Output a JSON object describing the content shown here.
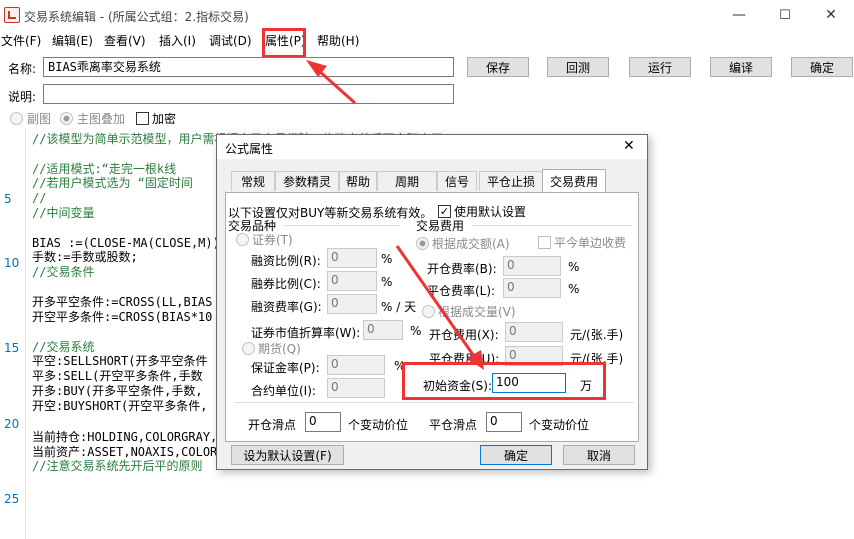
{
  "window": {
    "title": "交易系统编辑 - (所属公式组：2.指标交易)",
    "minimize": "—",
    "maximize": "☐",
    "close": "✕"
  },
  "menu": [
    "文件(F)",
    "编辑(E)",
    "查看(V)",
    "插入(I)",
    "调试(D)",
    "属性(P)",
    "帮助(H)"
  ],
  "form": {
    "name_label": "名称:",
    "name_value": "BIAS乖离率交易系统",
    "desc_label": "说明:",
    "desc_value": "",
    "radio_subchart": "副图",
    "radio_main_overlay": "主图叠加",
    "encrypt": "加密"
  },
  "toolbar": {
    "save": "保存",
    "revert": "回测",
    "run": "运行",
    "compile": "编译",
    "ok": "确定"
  },
  "gutter": [
    "5",
    "10",
    "15",
    "20",
    "25"
  ],
  "code": [
    {
      "t": "//该模型为简单示范模型，用户需根据自己交易经验，修改完善后再实际应用!!!"
    },
    {
      "t": ""
    },
    {
      "t": "//适用模式:“走完一根k线"
    },
    {
      "t": "//若用户模式选为 “固定时间"
    },
    {
      "t": "//"
    },
    {
      "t": "//中间变量"
    },
    {
      "t": ""
    },
    {
      "t": "BIAS :=(CLOSE-MA(CLOSE,M))/MA(CLOSE,M)*100;"
    },
    {
      "t": "手数:=手数或股数;"
    },
    {
      "t": "//交易条件"
    },
    {
      "t": ""
    },
    {
      "t": "开多平空条件:=CROSS(LL,BIAS"
    },
    {
      "t": "开空平多条件:=CROSS(BIAS*10"
    },
    {
      "t": ""
    },
    {
      "t": "//交易系统"
    },
    {
      "t": "平空:SELLSHORT(开多平空条件"
    },
    {
      "t": "平多:SELL(开空平多条件,手数"
    },
    {
      "t": "开多:BUY(开多平空条件,手数,"
    },
    {
      "t": "开空:BUYSHORT(开空平多条件,"
    },
    {
      "t": ""
    },
    {
      "t": "当前持仓:HOLDING,COLORGRAY,"
    },
    {
      "t": "当前资产:ASSET,NOAXIS,COLOR"
    },
    {
      "t": "//注意交易系统先开后平的原则"
    }
  ],
  "dialog": {
    "title": "公式属性",
    "close": "✕",
    "tabs": [
      "常规",
      "参数精灵",
      "帮助",
      "周期",
      "信号",
      "平仓止损",
      "交易费用"
    ],
    "active_tab": "交易费用",
    "note": "以下设置仅对BUY等新交易系统有效。",
    "use_default": "使用默认设置",
    "group_variety": "交易品种",
    "securities": "证券(T)",
    "margin_buy_ratio": "融资比例(R):",
    "margin_sell_ratio": "融券比例(C):",
    "margin_rate": "融资费率(G):",
    "margin_rate_unit": "% / 天",
    "discount_rate": "证券市值折算率(W):",
    "futures": "期货(Q)",
    "deposit_rate": "保证金率(P):",
    "contract_unit": "合约单位(I):",
    "val_zero": "0",
    "pct": "%",
    "group_fee": "交易费用",
    "by_turnover": "根据成交额(A)",
    "close_today_single": "平今单边收费",
    "open_fee_rate": "开仓费率(B):",
    "close_fee_rate": "平仓费率(L):",
    "by_volume": "根据成交量(V)",
    "open_fee": "开仓费用(X):",
    "close_fee": "平仓费用(U):",
    "per_lot": "元/(张.手)",
    "init_capital_label": "初始资金(S):",
    "init_capital_value": "100",
    "init_capital_unit": "万",
    "open_slip": "开仓滑点",
    "close_slip": "平仓滑点",
    "tick_unit": "个变动价位",
    "set_default": "设为默认设置(F)",
    "ok": "确定",
    "cancel": "取消"
  },
  "accent_red": "#ee3333"
}
